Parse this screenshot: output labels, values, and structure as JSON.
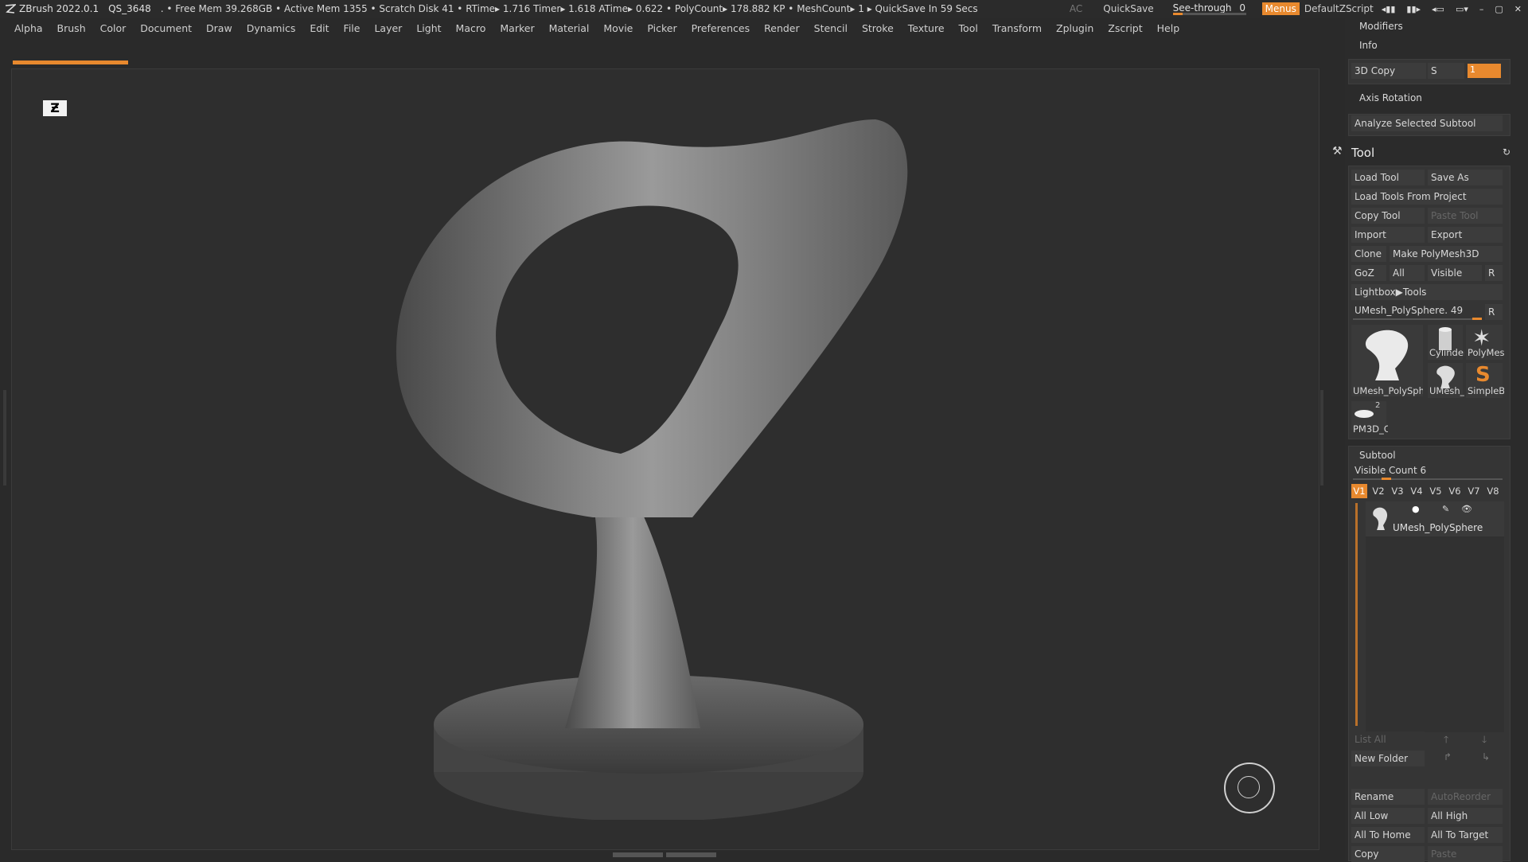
{
  "titlebar": {
    "app": "ZBrush 2022.0.1",
    "doc": "QS_3648",
    "stats": ". • Free Mem 39.268GB • Active Mem 1355 • Scratch Disk 41 • RTime▸ 1.716 Timer▸ 1.618 ATime▸ 0.622 • PolyCount▸ 178.882 KP • MeshCount▸ 1 ▸ QuickSave In 59 Secs",
    "ac": "AC",
    "quicksave": "QuickSave",
    "seethrough_label": "See-through",
    "seethrough_value": "0",
    "menus": "Menus",
    "script": "DefaultZScript"
  },
  "menubar": [
    "Alpha",
    "Brush",
    "Color",
    "Document",
    "Draw",
    "Dynamics",
    "Edit",
    "File",
    "Layer",
    "Light",
    "Macro",
    "Marker",
    "Material",
    "Movie",
    "Picker",
    "Preferences",
    "Render",
    "Stencil",
    "Stroke",
    "Texture",
    "Tool",
    "Transform",
    "Zplugin",
    "Zscript",
    "Help"
  ],
  "right_panel": {
    "modifiers": "Modifiers",
    "info": "Info",
    "copy3d": "3D Copy",
    "s_label": "S",
    "copy3d_value": "1",
    "axis_rotation": "Axis Rotation",
    "analyze": "Analyze Selected Subtool",
    "tool_title": "Tool",
    "buttons": {
      "load_tool": "Load Tool",
      "save_as": "Save As",
      "load_from_project": "Load Tools From Project",
      "copy_tool": "Copy Tool",
      "paste_tool": "Paste Tool",
      "import": "Import",
      "export": "Export",
      "clone": "Clone",
      "make_polymesh": "Make PolyMesh3D",
      "goz": "GoZ",
      "all": "All",
      "visible": "Visible",
      "r": "R",
      "lightbox_tools": "Lightbox▶Tools"
    },
    "current_tool": "UMesh_PolySphere. 49",
    "current_tool_r": "R",
    "thumbnails": [
      {
        "label": "UMesh_PolySphe"
      },
      {
        "label": "Cylinder"
      },
      {
        "label": "PolyMes"
      },
      {
        "label": "UMesh_"
      },
      {
        "label": "SimpleB"
      },
      {
        "label": "PM3D_C"
      }
    ],
    "pm3d_badge": "2",
    "subtool": {
      "title": "Subtool",
      "visible_count": "Visible Count 6",
      "tabs": [
        "V1",
        "V2",
        "V3",
        "V4",
        "V5",
        "V6",
        "V7",
        "V8"
      ],
      "active_tab": "V1",
      "item": "UMesh_PolySphere",
      "list_all": "List All",
      "new_folder": "New Folder",
      "rename": "Rename",
      "autoreorder": "AutoReorder",
      "all_low": "All Low",
      "all_high": "All High",
      "all_to_home": "All To Home",
      "all_to_target": "All To Target",
      "copy": "Copy",
      "paste": "Paste"
    }
  },
  "colors": {
    "accent": "#e8892e",
    "panel": "#2b2b2b",
    "button": "#3c3c3c",
    "canvas": "#2e2e2e"
  }
}
